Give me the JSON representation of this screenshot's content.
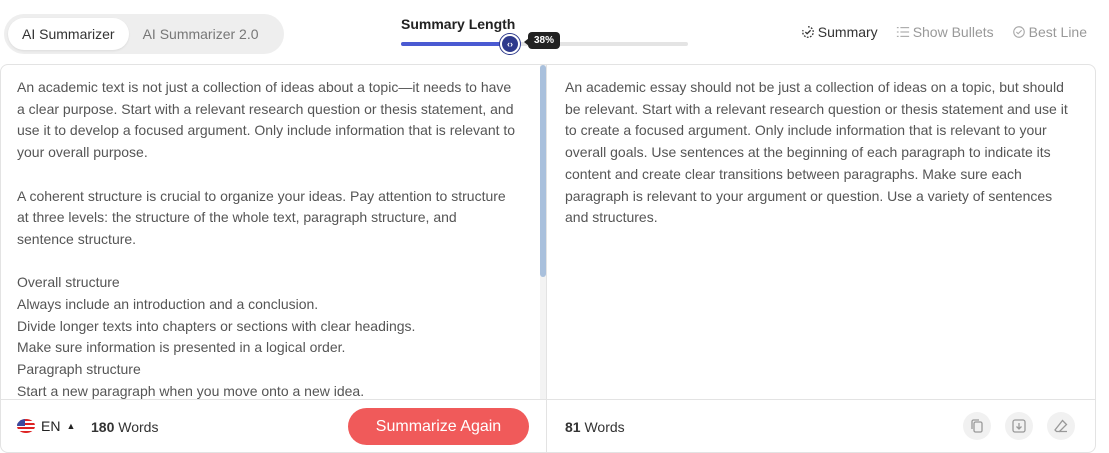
{
  "modes": [
    {
      "label": "AI Summarizer",
      "active": true
    },
    {
      "label": "AI Summarizer 2.0",
      "active": false
    }
  ],
  "length": {
    "title": "Summary Length",
    "percent_label": "38%",
    "value": 0.38
  },
  "view_options": [
    {
      "label": "Summary",
      "icon": "summary-icon",
      "active": true
    },
    {
      "label": "Show Bullets",
      "icon": "bullets-icon",
      "active": false
    },
    {
      "label": "Best Line",
      "icon": "best-line-icon",
      "active": false
    }
  ],
  "source": {
    "text": "An academic text is not just a collection of ideas about a topic—it needs to have a clear purpose. Start with a relevant research question or thesis statement, and use it to develop a focused argument. Only include information that is relevant to your overall purpose.\n\nA coherent structure is crucial to organize your ideas. Pay attention to structure at three levels: the structure of the whole text, paragraph structure, and sentence structure.\n\nOverall structure\nAlways include an introduction and a conclusion.\nDivide longer texts into chapters or sections with clear headings.\nMake sure information is presented in a logical order.\nParagraph structure\nStart a new paragraph when you move onto a new idea.",
    "language": "EN",
    "word_count": "180",
    "word_label": "Words"
  },
  "summary": {
    "text": "An academic essay should not be just a collection of ideas on a topic, but should be relevant. Start with a relevant research question or thesis statement and use it to create a focused argument. Only include information that is relevant to your overall goals. Use sentences at the beginning of each paragraph to indicate its content and create clear transitions between paragraphs. Make sure each paragraph is relevant to your argument or question. Use a variety of sentences and structures.",
    "word_count": "81",
    "word_label": "Words"
  },
  "actions": {
    "summarize_again": "Summarize Again"
  },
  "tools": [
    "copy-icon",
    "download-icon",
    "eraser-icon"
  ],
  "colors": {
    "accent": "#2e3a8c",
    "slider_fill": "#4a5ad2",
    "button": "#f05a5a"
  }
}
